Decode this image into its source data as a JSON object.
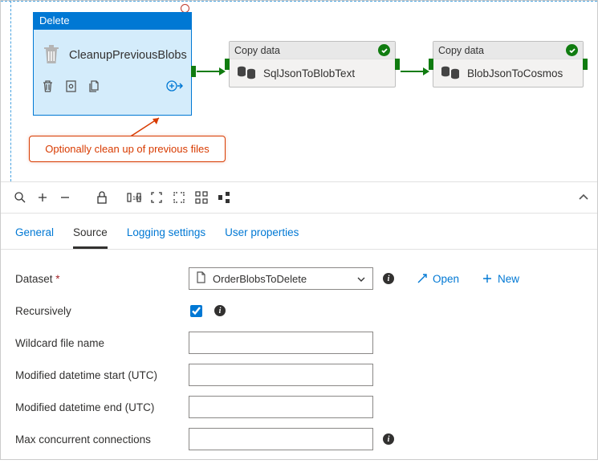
{
  "canvas": {
    "delete_node": {
      "type_label": "Delete",
      "name": "CleanupPreviousBlobs"
    },
    "copy_nodes": [
      {
        "type_label": "Copy data",
        "name": "SqlJsonToBlobText"
      },
      {
        "type_label": "Copy data",
        "name": "BlobJsonToCosmos"
      }
    ],
    "annotation": "Optionally clean up of previous files"
  },
  "tabs": {
    "general": "General",
    "source": "Source",
    "logging": "Logging settings",
    "user_props": "User properties"
  },
  "form": {
    "dataset_label": "Dataset",
    "dataset_value": "OrderBlobsToDelete",
    "open_label": "Open",
    "new_label": "New",
    "recursively_label": "Recursively",
    "recursively_checked": true,
    "wildcard_label": "Wildcard file name",
    "wildcard_value": "",
    "mod_start_label": "Modified datetime start (UTC)",
    "mod_start_value": "",
    "mod_end_label": "Modified datetime end (UTC)",
    "mod_end_value": "",
    "max_conn_label": "Max concurrent connections",
    "max_conn_value": ""
  }
}
